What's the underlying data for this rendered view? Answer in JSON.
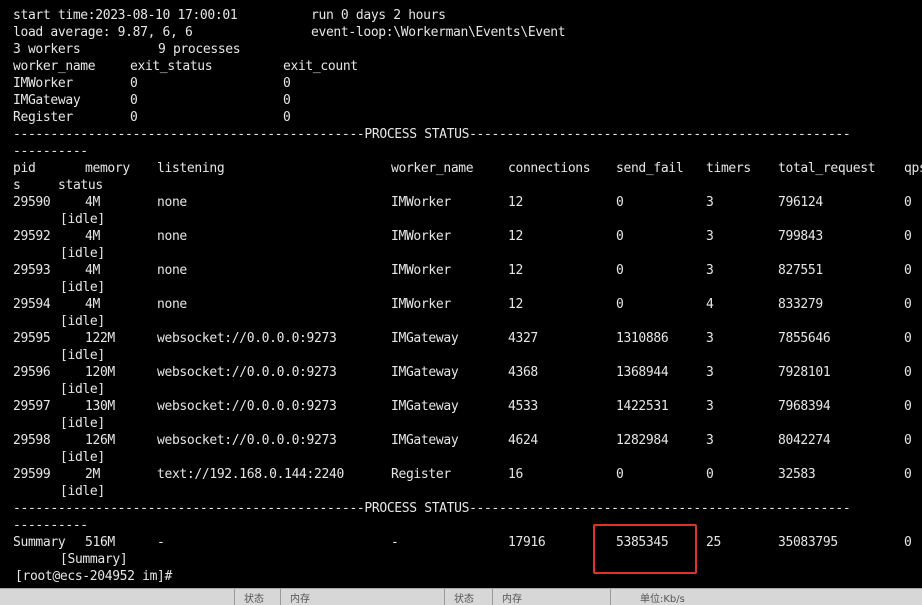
{
  "header": {
    "start_time": "start time:2023-08-10 17:00:01",
    "run_time": "run 0 days 2 hours",
    "load_average": "load average: 9.87, 6, 6",
    "event_loop": "event-loop:\\Workerman\\Events\\Event",
    "workers": "3 workers",
    "processes": "9 processes"
  },
  "worker_table": {
    "columns": [
      "worker_name",
      "exit_status",
      "exit_count"
    ],
    "rows": [
      [
        "IMWorker",
        "0",
        "0"
      ],
      [
        "IMGateway",
        "0",
        "0"
      ],
      [
        "Register",
        "0",
        "0"
      ]
    ]
  },
  "process_status_separator": "-----------------------------------------------PROCESS STATUS---------------------------------------------------",
  "separator_wrap": "----------",
  "process_table": {
    "columns": [
      "pid",
      "memory",
      "listening",
      "worker_name",
      "connections",
      "send_fail",
      "timers",
      "total_request",
      "qps",
      "status"
    ],
    "wrap_fragment": "s",
    "rows": [
      {
        "pid": "29590",
        "memory": "4M",
        "listening": "none",
        "worker_name": "IMWorker",
        "connections": "12",
        "send_fail": "0",
        "timers": "3",
        "total_request": "796124",
        "qps": "0",
        "status": "[idle]"
      },
      {
        "pid": "29592",
        "memory": "4M",
        "listening": "none",
        "worker_name": "IMWorker",
        "connections": "12",
        "send_fail": "0",
        "timers": "3",
        "total_request": "799843",
        "qps": "0",
        "status": "[idle]"
      },
      {
        "pid": "29593",
        "memory": "4M",
        "listening": "none",
        "worker_name": "IMWorker",
        "connections": "12",
        "send_fail": "0",
        "timers": "3",
        "total_request": "827551",
        "qps": "0",
        "status": "[idle]"
      },
      {
        "pid": "29594",
        "memory": "4M",
        "listening": "none",
        "worker_name": "IMWorker",
        "connections": "12",
        "send_fail": "0",
        "timers": "4",
        "total_request": "833279",
        "qps": "0",
        "status": "[idle]"
      },
      {
        "pid": "29595",
        "memory": "122M",
        "listening": "websocket://0.0.0.0:9273",
        "worker_name": "IMGateway",
        "connections": "4327",
        "send_fail": "1310886",
        "timers": "3",
        "total_request": "7855646",
        "qps": "0",
        "status": "[idle]"
      },
      {
        "pid": "29596",
        "memory": "120M",
        "listening": "websocket://0.0.0.0:9273",
        "worker_name": "IMGateway",
        "connections": "4368",
        "send_fail": "1368944",
        "timers": "3",
        "total_request": "7928101",
        "qps": "0",
        "status": "[idle]"
      },
      {
        "pid": "29597",
        "memory": "130M",
        "listening": "websocket://0.0.0.0:9273",
        "worker_name": "IMGateway",
        "connections": "4533",
        "send_fail": "1422531",
        "timers": "3",
        "total_request": "7968394",
        "qps": "0",
        "status": "[idle]"
      },
      {
        "pid": "29598",
        "memory": "126M",
        "listening": "websocket://0.0.0.0:9273",
        "worker_name": "IMGateway",
        "connections": "4624",
        "send_fail": "1282984",
        "timers": "3",
        "total_request": "8042274",
        "qps": "0",
        "status": "[idle]"
      },
      {
        "pid": "29599",
        "memory": "2M",
        "listening": "text://192.168.0.144:2240",
        "worker_name": "Register",
        "connections": "16",
        "send_fail": "0",
        "timers": "0",
        "total_request": "32583",
        "qps": "0",
        "status": "[idle]"
      }
    ],
    "summary": {
      "pid": "Summary",
      "memory": "516M",
      "listening": "-",
      "worker_name": "-",
      "connections": "17916",
      "send_fail": "5385345",
      "timers": "25",
      "total_request": "35083795",
      "qps": "0",
      "status": "[Summary]"
    }
  },
  "prompt": "[root@ecs-204952 im]#",
  "highlight_color": "#e0302a",
  "taskbar_fragments": [
    "状态",
    "内存",
    "状态",
    "内存",
    "单位:Kb/s"
  ]
}
